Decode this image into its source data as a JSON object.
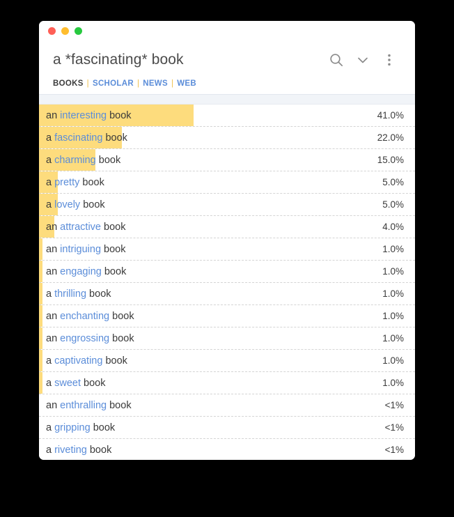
{
  "window": {
    "controls": [
      {
        "name": "close",
        "color": "#ff5f56"
      },
      {
        "name": "minimize",
        "color": "#ffbd2e"
      },
      {
        "name": "zoom",
        "color": "#27c93f"
      }
    ]
  },
  "header": {
    "query_title": "a *fascinating* book",
    "actions": [
      {
        "name": "search-icon",
        "label": "Search"
      },
      {
        "name": "chevron-down-icon",
        "label": "Expand"
      },
      {
        "name": "overflow-menu-icon",
        "label": "More options"
      }
    ],
    "tabs": [
      {
        "label": "BOOKS",
        "active": true
      },
      {
        "label": "SCHOLAR",
        "active": false
      },
      {
        "label": "NEWS",
        "active": false
      },
      {
        "label": "WEB",
        "active": false
      }
    ],
    "tab_separator": "|"
  },
  "results": [
    {
      "article": "an",
      "adjective": "interesting",
      "noun": "book",
      "value": "41.0%",
      "percent": 41.0
    },
    {
      "article": "a",
      "adjective": "fascinating",
      "noun": "book",
      "value": "22.0%",
      "percent": 22.0
    },
    {
      "article": "a",
      "adjective": "charming",
      "noun": "book",
      "value": "15.0%",
      "percent": 15.0
    },
    {
      "article": "a",
      "adjective": "pretty",
      "noun": "book",
      "value": "5.0%",
      "percent": 5.0
    },
    {
      "article": "a",
      "adjective": "lovely",
      "noun": "book",
      "value": "5.0%",
      "percent": 5.0
    },
    {
      "article": "an",
      "adjective": "attractive",
      "noun": "book",
      "value": "4.0%",
      "percent": 4.0
    },
    {
      "article": "an",
      "adjective": "intriguing",
      "noun": "book",
      "value": "1.0%",
      "percent": 1.0
    },
    {
      "article": "an",
      "adjective": "engaging",
      "noun": "book",
      "value": "1.0%",
      "percent": 1.0
    },
    {
      "article": "a",
      "adjective": "thrilling",
      "noun": "book",
      "value": "1.0%",
      "percent": 1.0
    },
    {
      "article": "an",
      "adjective": "enchanting",
      "noun": "book",
      "value": "1.0%",
      "percent": 1.0
    },
    {
      "article": "an",
      "adjective": "engrossing",
      "noun": "book",
      "value": "1.0%",
      "percent": 1.0
    },
    {
      "article": "a",
      "adjective": "captivating",
      "noun": "book",
      "value": "1.0%",
      "percent": 1.0
    },
    {
      "article": "a",
      "adjective": "sweet",
      "noun": "book",
      "value": "1.0%",
      "percent": 1.0
    },
    {
      "article": "an",
      "adjective": "enthralling",
      "noun": "book",
      "value": "<1%",
      "percent": 0.4
    },
    {
      "article": "a",
      "adjective": "gripping",
      "noun": "book",
      "value": "<1%",
      "percent": 0.4
    },
    {
      "article": "a",
      "adjective": "riveting",
      "noun": "book",
      "value": "<1%",
      "percent": 0.4
    }
  ],
  "colors": {
    "bar": "#fddc7d",
    "adjective": "#5b8dd9",
    "text": "#3a3a3a",
    "tab_separator": "#f0c14b",
    "header_band": "#f1f4f8"
  },
  "chart_data": {
    "type": "bar",
    "title": "a *fascinating* book",
    "xlabel": "",
    "ylabel": "",
    "categories": [
      "an interesting book",
      "a fascinating book",
      "a charming book",
      "a pretty book",
      "a lovely book",
      "an attractive book",
      "an intriguing book",
      "an engaging book",
      "a thrilling book",
      "an enchanting book",
      "an engrossing book",
      "a captivating book",
      "a sweet book",
      "an enthralling book",
      "a gripping book",
      "a riveting book"
    ],
    "values": [
      41.0,
      22.0,
      15.0,
      5.0,
      5.0,
      4.0,
      1.0,
      1.0,
      1.0,
      1.0,
      1.0,
      1.0,
      1.0,
      0.4,
      0.4,
      0.4
    ],
    "value_labels": [
      "41.0%",
      "22.0%",
      "15.0%",
      "5.0%",
      "5.0%",
      "4.0%",
      "1.0%",
      "1.0%",
      "1.0%",
      "1.0%",
      "1.0%",
      "1.0%",
      "1.0%",
      "<1%",
      "<1%",
      "<1%"
    ],
    "ylim": [
      0,
      41
    ],
    "grid": false,
    "legend": null
  }
}
